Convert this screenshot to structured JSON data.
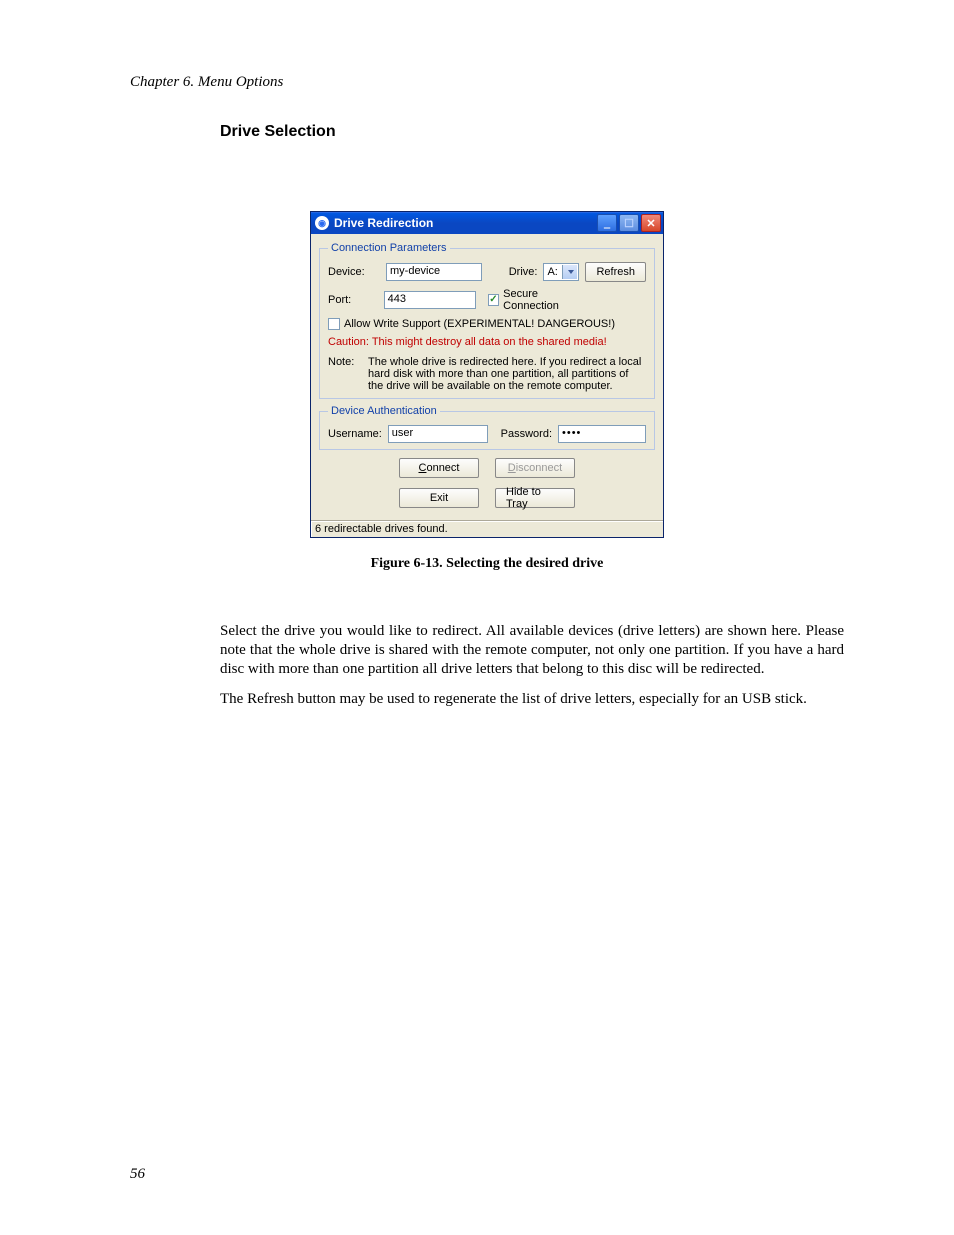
{
  "chapter_header": "Chapter 6. Menu Options",
  "section_title": "Drive Selection",
  "dialog": {
    "title": "Drive Redirection",
    "connection": {
      "legend": "Connection Parameters",
      "device_label": "Device:",
      "device_value": "my-device",
      "drive_label": "Drive:",
      "drive_value": "A:",
      "refresh_label": "Refresh",
      "port_label": "Port:",
      "port_value": "443",
      "secure_label": "Secure Connection",
      "secure_checked": "✓",
      "write_label": "Allow Write Support (EXPERIMENTAL! DANGEROUS!)",
      "caution_text": "Caution: This might destroy all data on the shared media!",
      "note_label": "Note:",
      "note_text": "The whole drive is redirected here. If you redirect a local hard disk with more than one partition, all partitions of the drive will be available on the remote computer."
    },
    "auth": {
      "legend": "Device Authentication",
      "username_label": "Username:",
      "username_value": "user",
      "password_label": "Password:",
      "password_value": "••••"
    },
    "connect_prefix": "C",
    "connect_suffix": "onnect",
    "disconnect_prefix": "D",
    "disconnect_suffix": "isconnect",
    "exit_label": "Exit",
    "hide_label": "Hide to Tray",
    "status_text": "6 redirectable drives found."
  },
  "figure_caption": "Figure 6-13. Selecting the desired drive",
  "para1": "Select the drive you would like to redirect. All available devices (drive letters) are shown here. Please note that the whole drive is shared with the remote computer, not only one partition. If you have a hard disc with more than one partition all drive letters that belong to this disc will be redirected.",
  "para2": "The Refresh button may be used to regenerate the list of drive letters, especially for an USB stick.",
  "page_number": "56"
}
